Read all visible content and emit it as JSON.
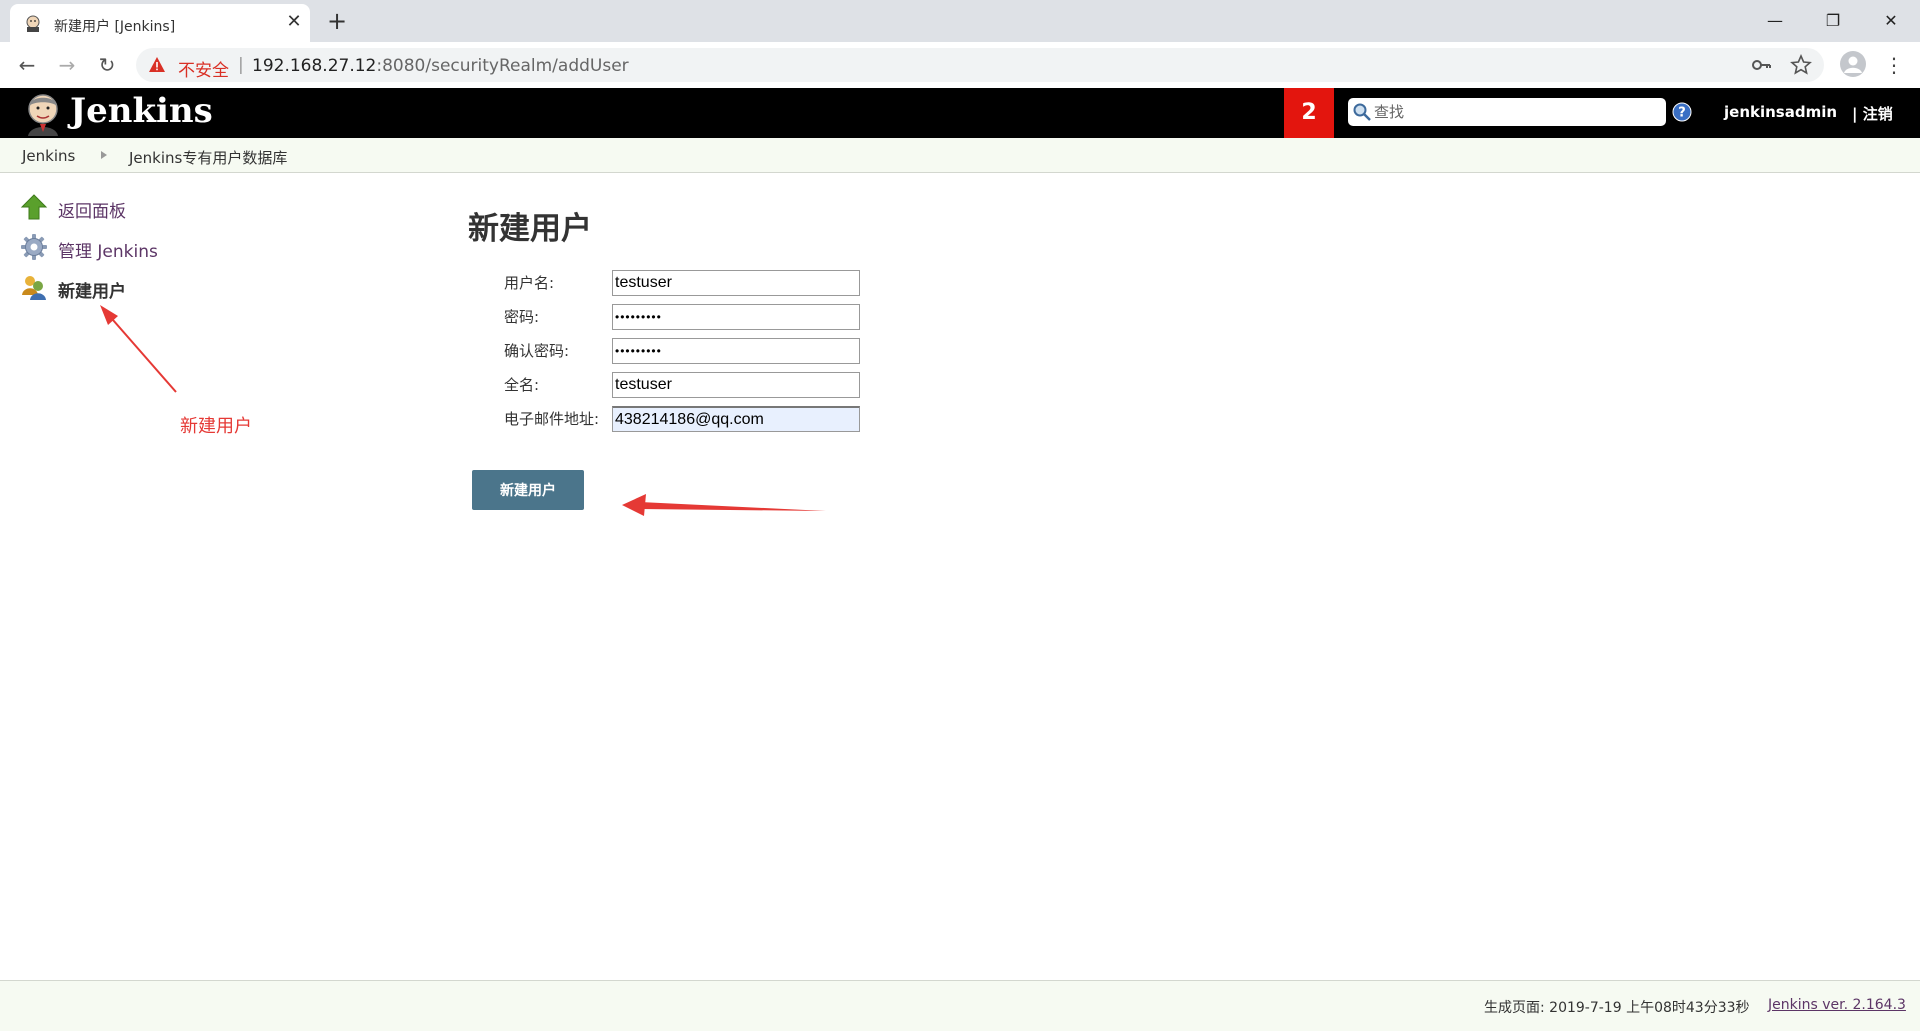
{
  "browser": {
    "tab_title": "新建用户 [Jenkins]",
    "tab_close": "✕",
    "new_tab": "+",
    "insecure_label": "不安全",
    "url_separator": "|",
    "url_host": "192.168.27.12",
    "url_rest": ":8080/securityRealm/addUser",
    "window_controls": {
      "minimize": "—",
      "maximize": "❐",
      "close": "✕"
    },
    "nav": {
      "back": "←",
      "forward": "→",
      "reload": "↻"
    },
    "menu": "⋮"
  },
  "header": {
    "title": "Jenkins",
    "notification_count": "2",
    "search_placeholder": "查找",
    "username": "jenkinsadmin",
    "logout": "| 注销"
  },
  "breadcrumb": {
    "items": [
      "Jenkins",
      "Jenkins专有用户数据库"
    ]
  },
  "sidebar": {
    "items": [
      {
        "label": "返回面板",
        "icon": "up-arrow-icon"
      },
      {
        "label": "管理 Jenkins",
        "icon": "gear-icon"
      },
      {
        "label": "新建用户",
        "icon": "users-icon"
      }
    ]
  },
  "annotation": {
    "text": "新建用户",
    "color": "#e53935"
  },
  "form": {
    "title": "新建用户",
    "fields": [
      {
        "label": "用户名:",
        "value": "testuser"
      },
      {
        "label": "密码:",
        "value": "•••••••••"
      },
      {
        "label": "确认密码:",
        "value": "•••••••••"
      },
      {
        "label": "全名:",
        "value": "testuser"
      },
      {
        "label": "电子邮件地址:",
        "value": "438214186@qq.com"
      }
    ],
    "submit_label": "新建用户"
  },
  "footer": {
    "generated": "生成页面: 2019-7-19 上午08时43分33秒",
    "version": "Jenkins ver. 2.164.3"
  },
  "colors": {
    "header_bg": "#000000",
    "badge_bg": "#e3150e",
    "button_bg": "#4b758b",
    "link": "#5c3566",
    "annotation": "#e53935"
  }
}
